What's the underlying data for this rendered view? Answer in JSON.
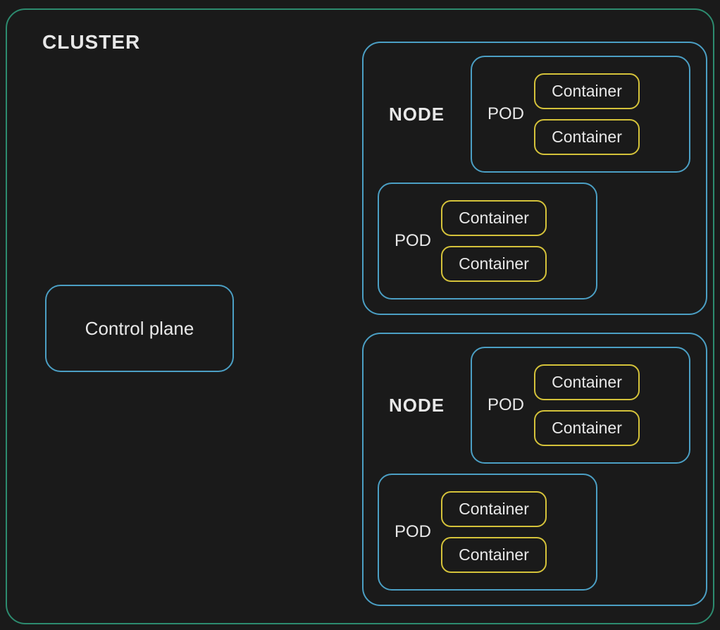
{
  "cluster": {
    "label": "CLUSTER",
    "control_plane": {
      "label": "Control plane"
    },
    "nodes": [
      {
        "label": "NODE",
        "pods": [
          {
            "label": "POD",
            "containers": [
              "Container",
              "Container"
            ]
          },
          {
            "label": "POD",
            "containers": [
              "Container",
              "Container"
            ]
          }
        ]
      },
      {
        "label": "NODE",
        "pods": [
          {
            "label": "POD",
            "containers": [
              "Container",
              "Container"
            ]
          },
          {
            "label": "POD",
            "containers": [
              "Container",
              "Container"
            ]
          }
        ]
      }
    ]
  },
  "colors": {
    "cluster_border": "#2d8b6f",
    "node_border": "#4b9fc4",
    "container_border": "#d4c23a",
    "background": "#1a1a1a",
    "text": "#e8e8e8"
  }
}
